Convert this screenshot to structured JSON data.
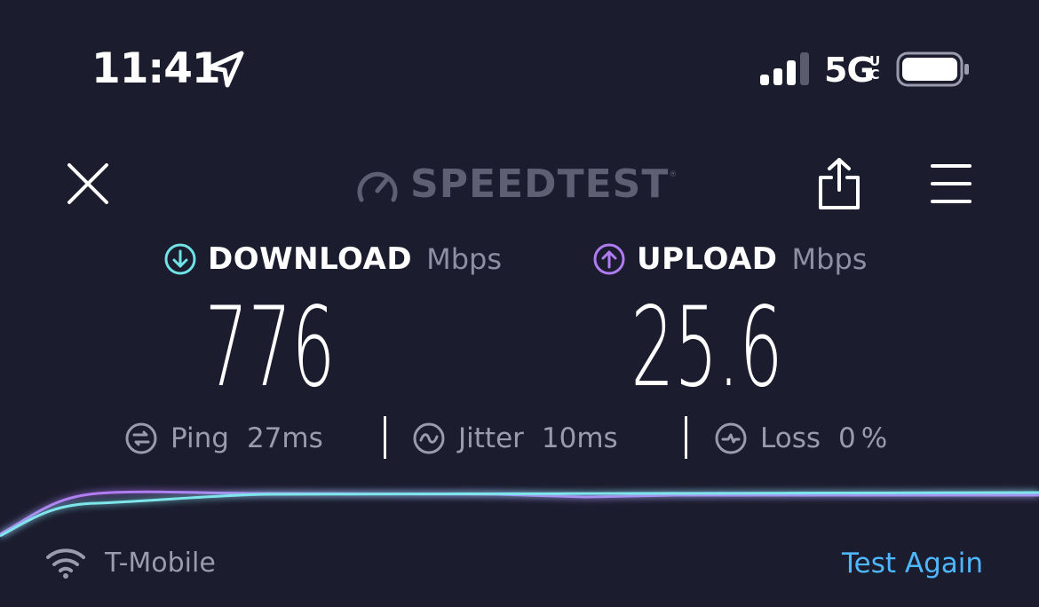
{
  "status_bar": {
    "time": "11:41",
    "network_type": "5G",
    "network_superscript": "UC",
    "icons": [
      "location-arrow-icon",
      "cellular-signal-icon",
      "battery-icon"
    ]
  },
  "header": {
    "logo_text": "SPEEDTEST",
    "logo_tm": "®",
    "icons": [
      "close-icon",
      "speedometer-icon",
      "share-icon",
      "hamburger-menu-icon"
    ]
  },
  "download": {
    "label": "DOWNLOAD",
    "unit": "Mbps",
    "value": "776",
    "icon": "download-arrow-icon",
    "color": "#6fe3e6"
  },
  "upload": {
    "label": "UPLOAD",
    "unit": "Mbps",
    "value": "25.6",
    "icon": "upload-arrow-icon",
    "color": "#b07cf2"
  },
  "stats": {
    "ping": {
      "label": "Ping",
      "value": "27",
      "unit": "ms",
      "icon": "ping-icon"
    },
    "jitter": {
      "label": "Jitter",
      "value": "10",
      "unit": "ms",
      "icon": "jitter-icon"
    },
    "loss": {
      "label": "Loss",
      "value": "0",
      "unit": "%",
      "icon": "loss-icon"
    }
  },
  "footer": {
    "carrier": "T-Mobile",
    "test_again": "Test Again",
    "wifi_icon": "wifi-icon"
  },
  "colors": {
    "background": "#1b1c2e",
    "accent_link": "#4db8ff",
    "muted_text": "#9a9bad",
    "logo": "#5e5f72"
  }
}
